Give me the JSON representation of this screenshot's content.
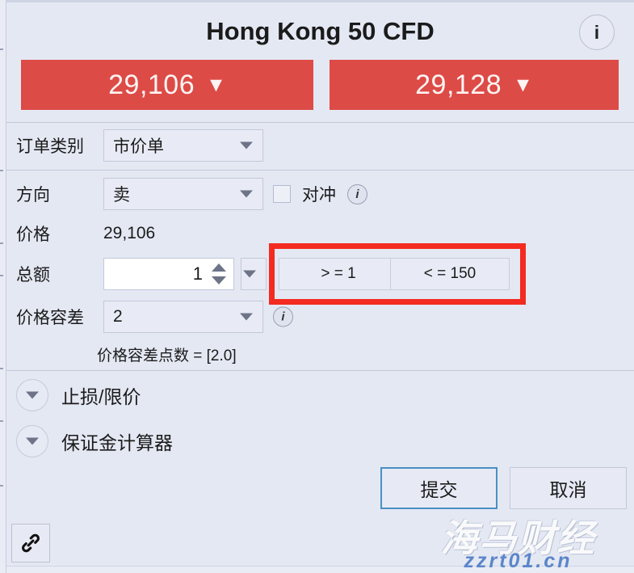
{
  "header": {
    "title": "Hong Kong 50 CFD",
    "info_icon": "info-icon",
    "bid": {
      "value": "29,106",
      "arrow": "▼"
    },
    "ask": {
      "value": "29,128",
      "arrow": "▼"
    }
  },
  "form": {
    "order_type": {
      "label": "订单类别",
      "value": "市价单"
    },
    "direction": {
      "label": "方向",
      "value": "卖"
    },
    "hedge": {
      "label": "对冲",
      "checked": false,
      "info_icon": "info-icon"
    },
    "price": {
      "label": "价格",
      "value": "29,106"
    },
    "quantity": {
      "label": "总额",
      "value": "1",
      "min_button": "> = 1",
      "max_button": "< = 150"
    },
    "tolerance": {
      "label": "价格容差",
      "value": "2",
      "info_icon": "info-icon",
      "note": "价格容差点数 = [2.0]"
    }
  },
  "sections": [
    {
      "label": "止损/限价",
      "expanded": false
    },
    {
      "label": "保证金计算器",
      "expanded": false
    }
  ],
  "footer": {
    "submit": "提交",
    "cancel": "取消",
    "link_icon": "chain-link-icon"
  },
  "watermark": {
    "brand": "海马财经",
    "url": "zzrt01.cn"
  },
  "colors": {
    "price_red": "#dd4b47",
    "annotation_red": "#f32b20",
    "focus_blue": "#4a90c4",
    "panel_bg": "#e4e8f3"
  }
}
